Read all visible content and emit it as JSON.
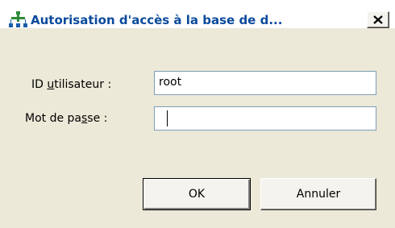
{
  "window": {
    "title": "Autorisation d'accès à la base de d...",
    "icon": "database-access-icon",
    "close_glyph": "close-icon"
  },
  "form": {
    "user_id": {
      "label_before": "ID ",
      "label_access_key": "u",
      "label_after": "tilisateur :",
      "value": "root"
    },
    "password": {
      "label_before": "Mot de pa",
      "label_access_key": "s",
      "label_after": "se :",
      "value": ""
    }
  },
  "buttons": {
    "ok": "OK",
    "cancel": "Annuler"
  },
  "colors": {
    "title_text": "#0a4a9c",
    "dialog_background": "#ece9d8",
    "field_border": "#7f9db9"
  }
}
